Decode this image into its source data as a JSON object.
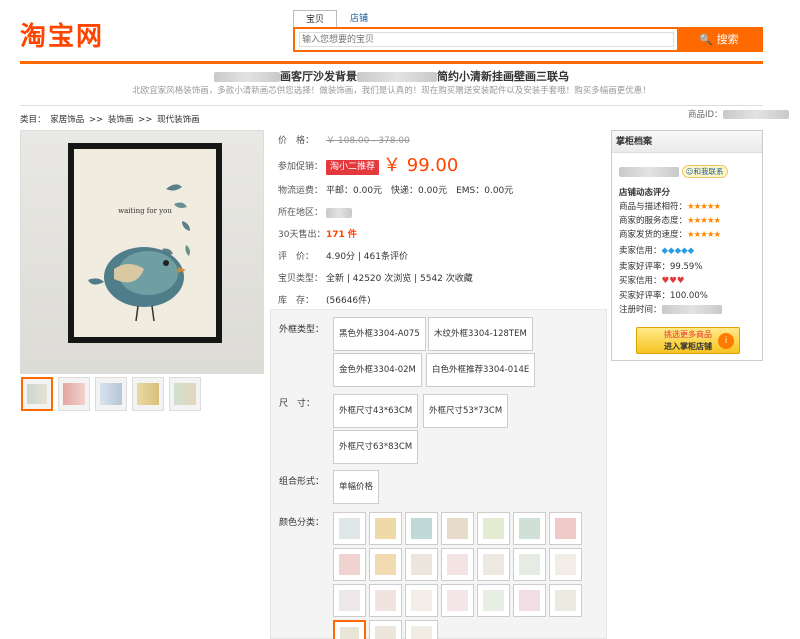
{
  "header": {
    "logo": "淘宝网",
    "tabs": [
      "宝贝",
      "店铺"
    ],
    "search_placeholder": "输入您想要的宝贝",
    "search_button": "搜索"
  },
  "product": {
    "title_suffix": "画客厅沙发背景",
    "title_end": "简约小清新挂画壁画三联乌",
    "subtitle": "北欧宜家风格装饰画，多款小清新画芯供您选择！做装饰画，我们是认真的！现在购买赠送安装配件以及安装手套哦！购买多幅画更优惠！",
    "poster_text": "waiting for you"
  },
  "breadcrumb": [
    "类目：",
    "家居饰品",
    ">>",
    "装饰画",
    ">>",
    "现代装饰画"
  ],
  "product_id_label": "商品ID：",
  "details": {
    "price_label": "价　格：",
    "price_value": "￥ 108.00 - 378.00",
    "promo_label": "参加促销：",
    "promo_tag": "淘小二推荐",
    "promo_price": "￥ 99.00",
    "shipping_label": "物流运费：",
    "shipping_value": "平邮：0.00元　快递：0.00元　EMS：0.00元",
    "location_label": "所在地区：",
    "sold_label": "30天售出：",
    "sold_value": "171 件",
    "rating_label": "评　价：",
    "rating_value": "4.90分 | 461条评价",
    "type_label": "宝贝类型：",
    "type_value": "全新 | 42520 次浏览 | 5542 次收藏",
    "stock_label": "库　存：",
    "stock_value": "(56646件)"
  },
  "options": {
    "frame_label": "外框类型：",
    "frame_types": [
      "黑色外框3304-A075",
      "木纹外框3304-128TEM",
      "金色外框3304-02M",
      "白色外框推荐3304-014E"
    ],
    "size_label": "尺　寸：",
    "sizes": [
      "外框尺寸43*63CM",
      "外框尺寸53*73CM",
      "外框尺寸63*83CM"
    ],
    "combo_label": "组合形式：",
    "combo_values": [
      "单幅价格"
    ],
    "color_label": "颜色分类："
  },
  "seller": {
    "header": "掌柜档案",
    "contact": "和我联系",
    "dynamic_title": "店铺动态评分",
    "ratings": [
      {
        "label": "商品与描述相符：",
        "stars": "★★★★★"
      },
      {
        "label": "商家的服务态度：",
        "stars": "★★★★★"
      },
      {
        "label": "商家发货的速度：",
        "stars": "★★★★★"
      }
    ],
    "seller_credit_label": "卖家信用：",
    "seller_credit_icons": "◆◆◆◆◆",
    "seller_good_rate": "卖家好评率：99.59%",
    "buyer_credit_label": "买家信用：",
    "buyer_credit_icons": "♥♥♥",
    "buyer_good_rate": "买家好评率：100.00%",
    "register_label": "注册时间：",
    "shop_btn_line1": "挑选更多商品",
    "shop_btn_line2": "进入掌柜店铺"
  }
}
